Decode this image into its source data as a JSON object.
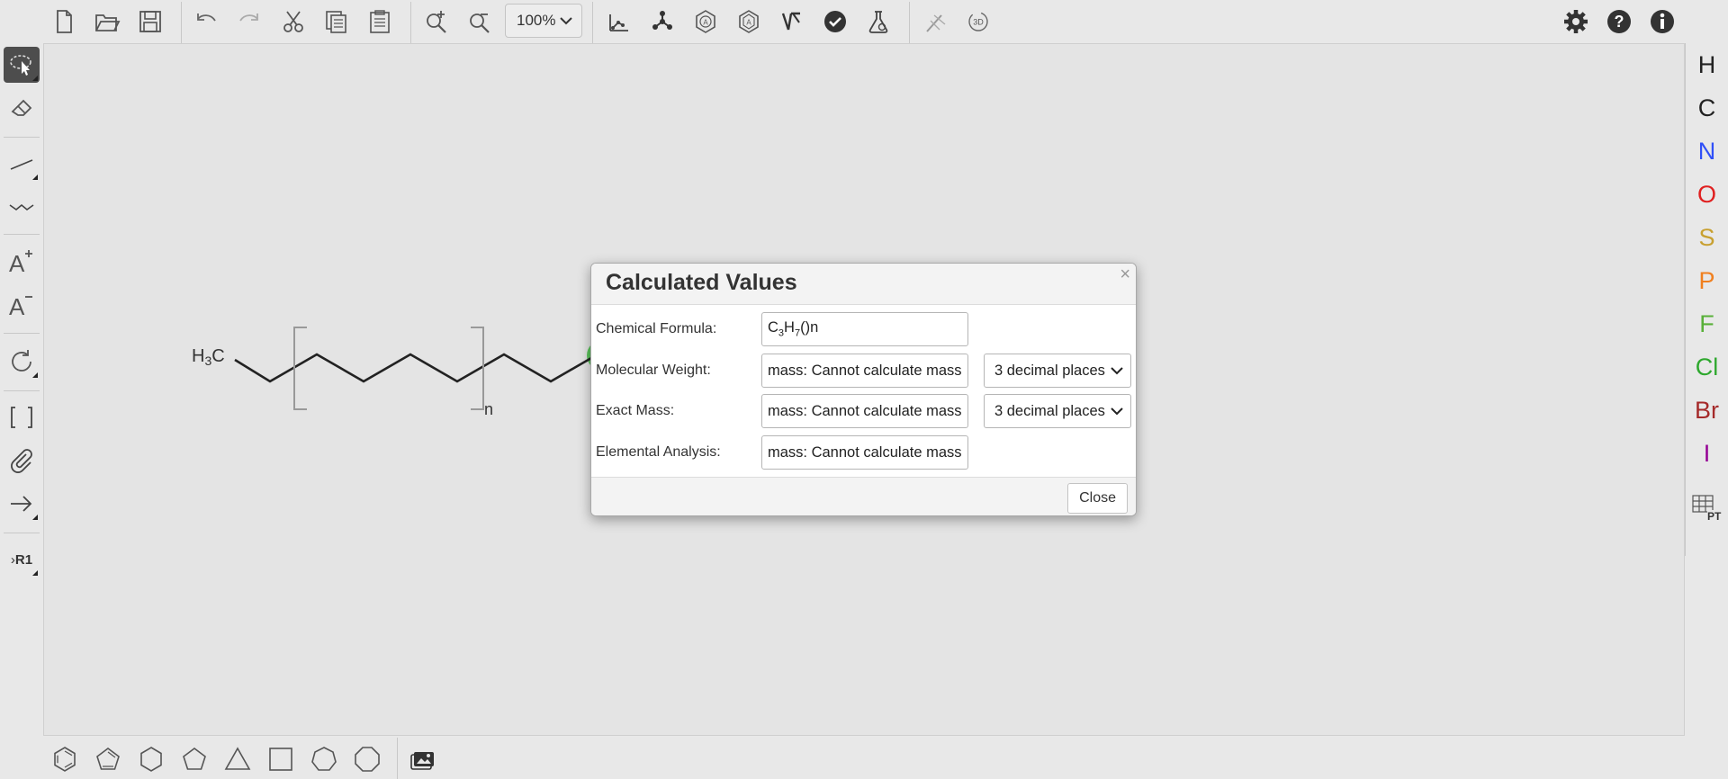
{
  "toolbar": {
    "zoom_value": "100%",
    "icons": [
      "new-document",
      "open-folder",
      "save",
      "undo",
      "redo",
      "cut",
      "copy",
      "paste",
      "zoom-in",
      "zoom-out",
      "clean-2d",
      "clean-3d",
      "aromatize",
      "dearomatize",
      "calculate-cip",
      "check-structure",
      "calculated-values",
      "stereochemistry",
      "3d-viewer",
      "settings",
      "help",
      "about"
    ]
  },
  "left_tools": {
    "icons": [
      "lasso-select",
      "eraser",
      "single-bond",
      "chain",
      "charge-plus",
      "charge-minus",
      "rotate",
      "sgroup-brackets",
      "attachment-point",
      "reaction-arrow",
      "rgroup-label"
    ],
    "rgroup_label": "R1"
  },
  "right_atoms": [
    {
      "symbol": "H",
      "color": "#222222"
    },
    {
      "symbol": "C",
      "color": "#222222"
    },
    {
      "symbol": "N",
      "color": "#3050F8"
    },
    {
      "symbol": "O",
      "color": "#E02020"
    },
    {
      "symbol": "S",
      "color": "#C8A030"
    },
    {
      "symbol": "P",
      "color": "#F08020"
    },
    {
      "symbol": "F",
      "color": "#58B038"
    },
    {
      "symbol": "Cl",
      "color": "#2EA82E"
    },
    {
      "symbol": "Br",
      "color": "#A52A2A"
    },
    {
      "symbol": "I",
      "color": "#940094"
    }
  ],
  "periodic_table_label": "PT",
  "molecule": {
    "end_group_label": "H3C",
    "end_group_main": "H",
    "end_group_sub": "3",
    "end_group_tail": "C",
    "repeat_label": "n",
    "highlight_color": "#5cc45c"
  },
  "dialog": {
    "title": "Calculated Values",
    "close_x": "×",
    "rows": [
      {
        "label": "Chemical Formula:",
        "value": "C3H7()n"
      },
      {
        "label": "Molecular Weight:",
        "value": "mass: Cannot calculate mass",
        "precision": "3 decimal places"
      },
      {
        "label": "Exact Mass:",
        "value": "mass: Cannot calculate mass",
        "precision": "3 decimal places"
      },
      {
        "label": "Elemental Analysis:",
        "value": "mass: Cannot calculate mass"
      }
    ],
    "close_button": "Close"
  }
}
